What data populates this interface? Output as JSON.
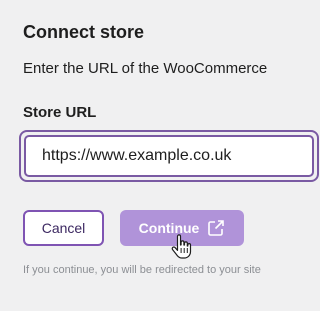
{
  "dialog": {
    "title": "Connect store",
    "subtitle": "Enter the URL of the WooCommerce",
    "store_url": {
      "label": "Store URL",
      "value": "https://www.example.co.uk"
    },
    "buttons": {
      "cancel_label": "Cancel",
      "continue_label": "Continue",
      "continue_icon": "external-link-icon"
    },
    "note": "If you continue, you will be redirected to your site"
  },
  "colors": {
    "accent": "#7f54b3",
    "continue_bg": "#b093d9",
    "background": "#f0f0f1",
    "note_text": "#8c8f94"
  }
}
